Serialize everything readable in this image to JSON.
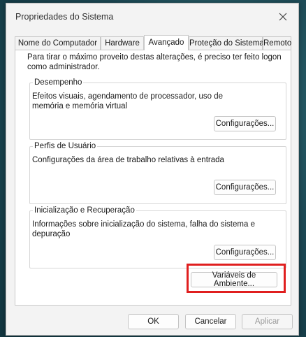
{
  "window": {
    "title": "Propriedades do Sistema"
  },
  "tabs": [
    {
      "label": "Nome do Computador"
    },
    {
      "label": "Hardware"
    },
    {
      "label": "Avançado"
    },
    {
      "label": "Proteção do Sistema"
    },
    {
      "label": "Remoto"
    }
  ],
  "active_tab": "Avançado",
  "intro_text": "Para tirar o máximo proveito destas alterações, é preciso ter feito logon como administrador.",
  "groups": {
    "performance": {
      "title": "Desempenho",
      "description": "Efeitos visuais, agendamento de processador, uso de memória e memória virtual",
      "button": "Configurações..."
    },
    "user_profiles": {
      "title": "Perfis de Usuário",
      "description": "Configurações da área de trabalho relativas à entrada",
      "button": "Configurações..."
    },
    "startup_recovery": {
      "title": "Inicialização e Recuperação",
      "description": "Informações sobre inicialização do sistema, falha do sistema e depuração",
      "button": "Configurações..."
    }
  },
  "env_button": "Variáveis de Ambiente...",
  "footer": {
    "ok": "OK",
    "cancel": "Cancelar",
    "apply": "Aplicar"
  },
  "colors": {
    "highlight": "#e01f1f",
    "window_bg": "#f3f3f3",
    "panel_bg": "#ffffff"
  },
  "icons": {
    "close": "close-icon"
  }
}
